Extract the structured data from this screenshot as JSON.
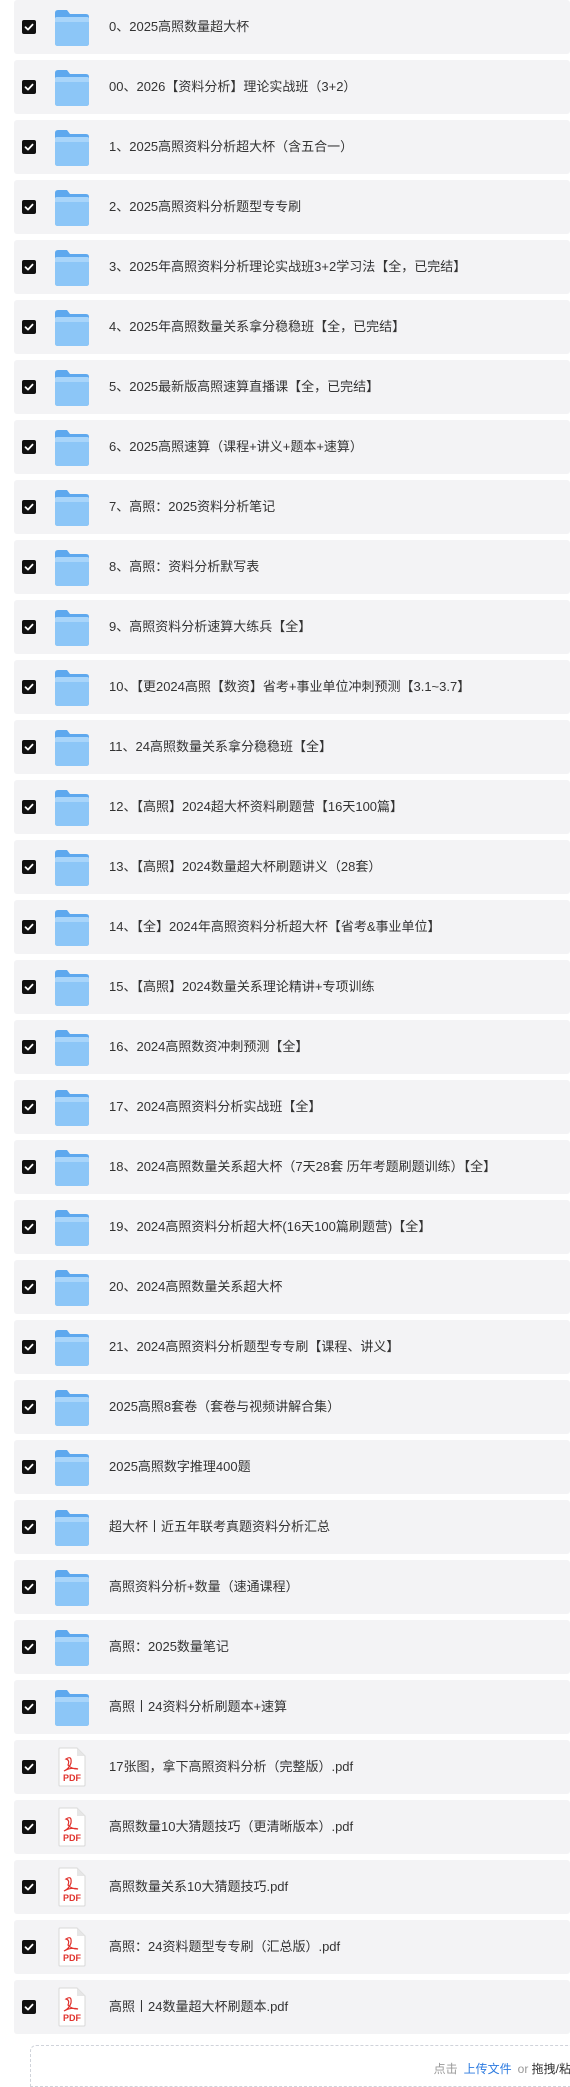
{
  "files": [
    {
      "name": "0、2025高照数量超大杯",
      "type": "folder"
    },
    {
      "name": "00、2026【资料分析】理论实战班（3+2）",
      "type": "folder"
    },
    {
      "name": "1、2025高照资料分析超大杯（含五合一）",
      "type": "folder"
    },
    {
      "name": "2、2025高照资料分析题型专专刷",
      "type": "folder"
    },
    {
      "name": "3、2025年高照资料分析理论实战班3+2学习法【全，已完结】",
      "type": "folder"
    },
    {
      "name": "4、2025年高照数量关系拿分稳稳班【全，已完结】",
      "type": "folder"
    },
    {
      "name": "5、2025最新版高照速算直播课【全，已完结】",
      "type": "folder"
    },
    {
      "name": "6、2025高照速算（课程+讲义+题本+速算）",
      "type": "folder"
    },
    {
      "name": "7、高照：2025资料分析笔记",
      "type": "folder"
    },
    {
      "name": "8、高照：资料分析默写表",
      "type": "folder"
    },
    {
      "name": "9、高照资料分析速算大练兵【全】",
      "type": "folder"
    },
    {
      "name": "10、【更2024高照【数资】省考+事业单位冲刺预测【3.1~3.7】",
      "type": "folder"
    },
    {
      "name": "11、24高照数量关系拿分稳稳班【全】",
      "type": "folder"
    },
    {
      "name": "12、【高照】2024超大杯资料刷题营【16天100篇】",
      "type": "folder"
    },
    {
      "name": "13、【高照】2024数量超大杯刷题讲义（28套）",
      "type": "folder"
    },
    {
      "name": "14、【全】2024年高照资料分析超大杯【省考&事业单位】",
      "type": "folder"
    },
    {
      "name": "15、【高照】2024数量关系理论精讲+专项训练",
      "type": "folder"
    },
    {
      "name": "16、2024高照数资冲刺预测【全】",
      "type": "folder"
    },
    {
      "name": "17、2024高照资料分析实战班【全】",
      "type": "folder"
    },
    {
      "name": "18、2024高照数量关系超大杯（7天28套 历年考题刷题训练）【全】",
      "type": "folder"
    },
    {
      "name": "19、2024高照资料分析超大杯(16天100篇刷题营)【全】",
      "type": "folder"
    },
    {
      "name": "20、2024高照数量关系超大杯",
      "type": "folder"
    },
    {
      "name": "21、2024高照资料分析题型专专刷【课程、讲义】",
      "type": "folder"
    },
    {
      "name": "2025高照8套卷（套卷与视频讲解合集）",
      "type": "folder"
    },
    {
      "name": "2025高照数字推理400题",
      "type": "folder"
    },
    {
      "name": "超大杯丨近五年联考真题资料分析汇总",
      "type": "folder"
    },
    {
      "name": "高照资料分析+数量（速通课程）",
      "type": "folder"
    },
    {
      "name": "高照：2025数量笔记",
      "type": "folder"
    },
    {
      "name": "高照丨24资料分析刷题本+速算",
      "type": "folder"
    },
    {
      "name": "17张图，拿下高照资料分析（完整版）.pdf",
      "type": "pdf"
    },
    {
      "name": "高照数量10大猜题技巧（更清晰版本）.pdf",
      "type": "pdf"
    },
    {
      "name": "高照数量关系10大猜题技巧.pdf",
      "type": "pdf"
    },
    {
      "name": "高照：24资料题型专专刷（汇总版）.pdf",
      "type": "pdf"
    },
    {
      "name": "高照丨24数量超大杯刷题本.pdf",
      "type": "pdf"
    }
  ],
  "upload": {
    "prefix": "点击",
    "link": "上传文件",
    "or": "or",
    "drag": "拖拽/粘"
  },
  "pdf_label": "PDF",
  "colors": {
    "row_bg": "#f3f3f5",
    "checkbox": "#111111",
    "folder": "#7fbdf5",
    "pdf": "#e0322d",
    "link": "#2d7be0"
  }
}
